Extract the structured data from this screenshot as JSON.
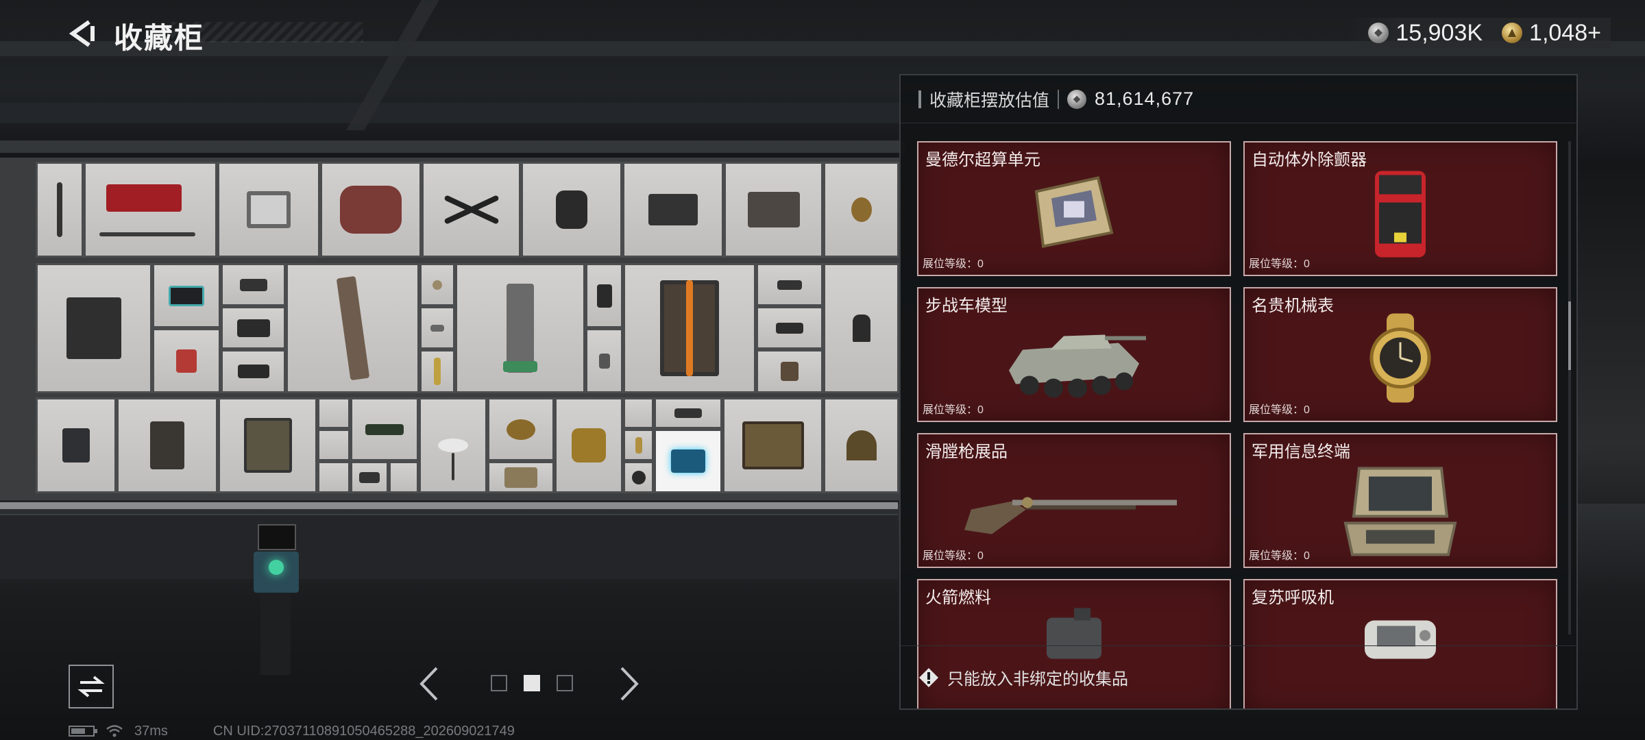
{
  "header": {
    "title": "收藏柜",
    "currency": [
      {
        "icon": "silver-coin-icon",
        "value": "15,903K"
      },
      {
        "icon": "gold-coin-icon",
        "value": "1,048+"
      }
    ]
  },
  "panel": {
    "estimate_label": "收藏柜摆放估值",
    "estimate_value": "81,614,677",
    "items": [
      {
        "name": "曼德尔超算单元",
        "level": "展位等级：0",
        "icon": "computing-unit-icon"
      },
      {
        "name": "自动体外除颤器",
        "level": "展位等级：0",
        "icon": "defibrillator-icon"
      },
      {
        "name": "步战车模型",
        "level": "展位等级：0",
        "icon": "ifv-model-icon"
      },
      {
        "name": "名贵机械表",
        "level": "展位等级：0",
        "icon": "mechanical-watch-icon"
      },
      {
        "name": "滑膛枪展品",
        "level": "展位等级：0",
        "icon": "musket-icon"
      },
      {
        "name": "军用信息终端",
        "level": "展位等级：0",
        "icon": "military-terminal-icon"
      },
      {
        "name": "火箭燃料",
        "level": "",
        "icon": "rocket-fuel-icon"
      },
      {
        "name": "复苏呼吸机",
        "level": "",
        "icon": "ventilator-icon"
      }
    ],
    "footer_note": "只能放入非绑定的收集品"
  },
  "pager": {
    "pages": 3,
    "active": 2
  },
  "status": {
    "ping": "37ms",
    "uid": "CN UID:2703711089105046528​8_202609021749"
  },
  "colors": {
    "card_bg": "#4b1518",
    "card_border": "#c9a9aa",
    "panel_bg": "#121416"
  }
}
